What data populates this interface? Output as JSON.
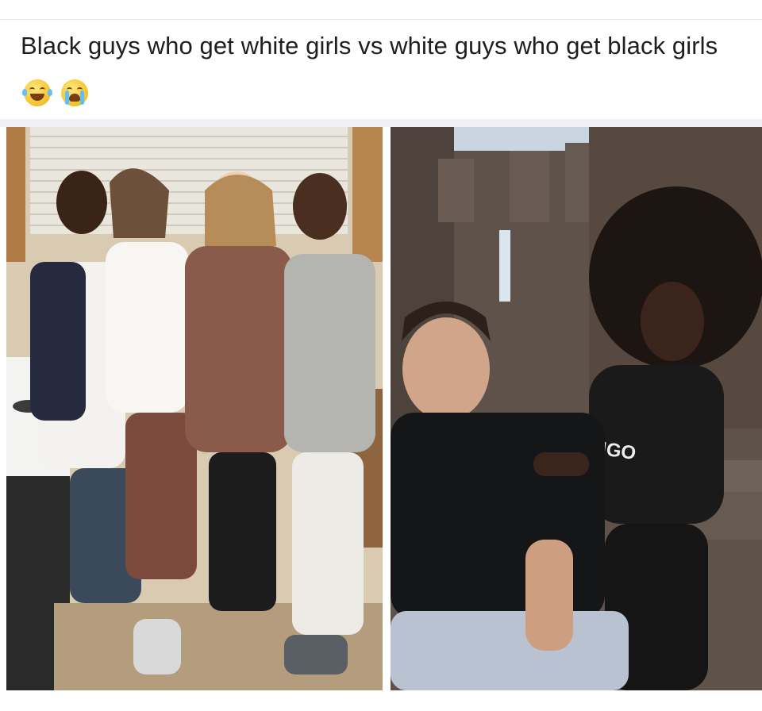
{
  "post": {
    "caption": "Black guys who get white girls vs white guys who get black girls",
    "emojis": [
      "face-with-tears-of-joy-icon",
      "loudly-crying-face-icon"
    ]
  },
  "images": {
    "left_photo": {
      "description_visible_text": ""
    },
    "right_photo": {
      "shirt_text": "UNGO"
    }
  },
  "colors": {
    "text": "#1c1e21",
    "divider": "#eef0f3"
  }
}
